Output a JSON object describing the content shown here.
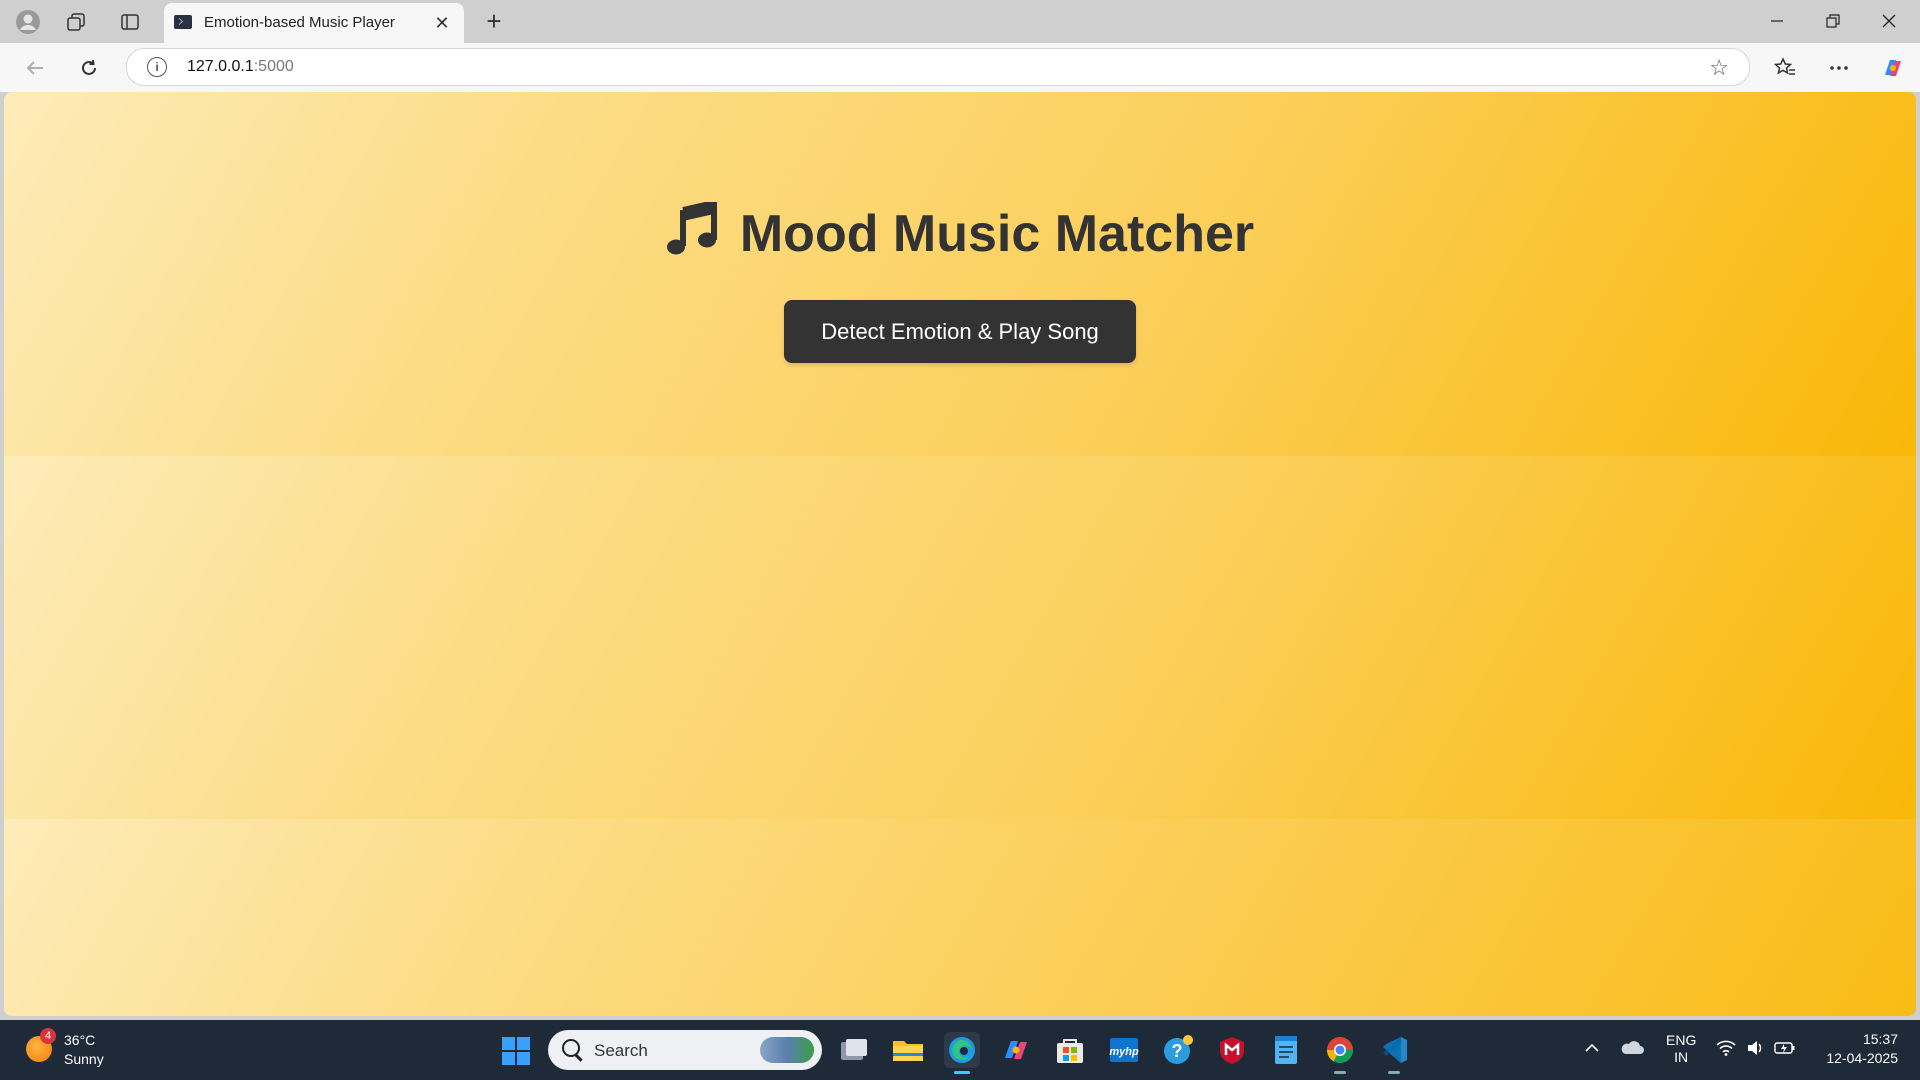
{
  "browser": {
    "tab_title": "Emotion-based Music Player",
    "new_tab_label": "+",
    "close_tab_label": "✕",
    "url_host": "127.0.0.1",
    "url_port": ":5000"
  },
  "page": {
    "heading": "Mood Music Matcher",
    "heading_icon": "♫",
    "button_label": "Detect Emotion & Play Song"
  },
  "taskbar": {
    "weather_badge": "4",
    "weather_temp": "36°C",
    "weather_condition": "Sunny",
    "search_placeholder": "Search",
    "lang_top": "ENG",
    "lang_bottom": "IN",
    "time": "15:37",
    "date": "12-04-2025",
    "apps": [
      "task-view",
      "file-explorer",
      "edge",
      "copilot",
      "store",
      "myhp",
      "help",
      "mcafee",
      "notepad",
      "chrome",
      "vscode"
    ]
  },
  "colors": {
    "gradient_start": "#fdebb8",
    "gradient_end": "#f9b707",
    "button_bg": "#333333",
    "heading_color": "#333333"
  }
}
